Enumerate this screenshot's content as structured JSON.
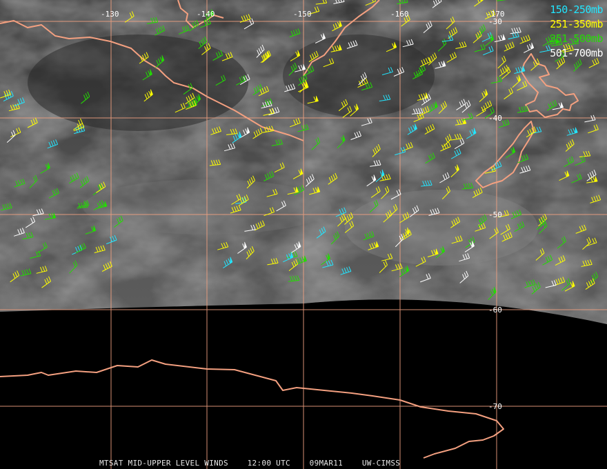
{
  "legend": [
    {
      "label": "150-250mb",
      "color": "#22e6ff"
    },
    {
      "label": "251-350mb",
      "color": "#ffff00"
    },
    {
      "label": "351-500mb",
      "color": "#22dd00"
    },
    {
      "label": "501-700mb",
      "color": "#ffffff"
    }
  ],
  "longitudes": [
    "-130",
    "-140",
    "-150",
    "-160",
    "-170"
  ],
  "latitudes": [
    "-30",
    "-40",
    "-50",
    "-60",
    "-70"
  ],
  "footer": {
    "product": "MTSAT MID-UPPER LEVEL WINDS",
    "time": "12:00 UTC",
    "date": "09MAR11",
    "source": "UW-CIMSS"
  },
  "colors": {
    "grid": "#f0a080",
    "coast": "#f4a080",
    "cloud_base": "#5a5a5a"
  }
}
